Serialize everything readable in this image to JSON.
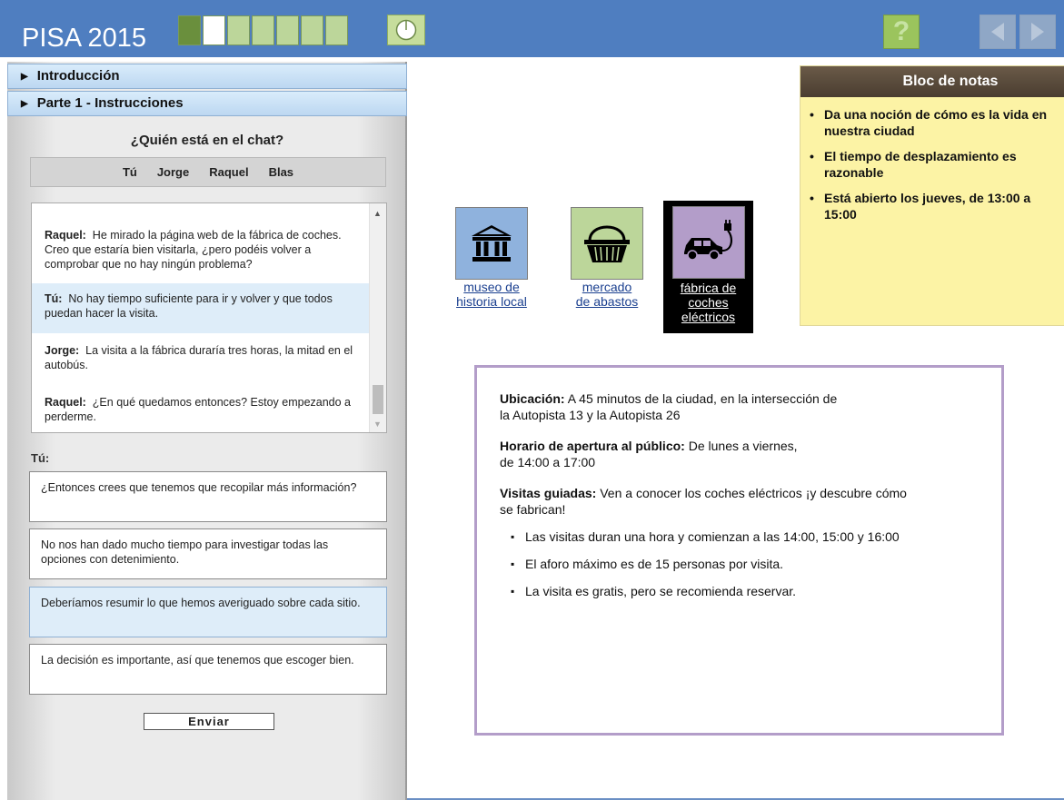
{
  "header": {
    "title": "PISA 2015",
    "progress_total": 7,
    "progress_current": 2,
    "help_symbol": "?",
    "colors": {
      "bar": "#4f7ec0",
      "progress_done": "#6a8f3d",
      "progress_current": "#ffffff",
      "progress_todo": "#bcd69a"
    }
  },
  "left_panel": {
    "sections": [
      {
        "label": "Introducción"
      },
      {
        "label": "Parte 1 - Instrucciones"
      }
    ],
    "chat": {
      "question": "¿Quién está en el chat?",
      "participants": [
        "Tú",
        "Jorge",
        "Raquel",
        "Blas"
      ],
      "messages": [
        {
          "speaker": "Raquel:",
          "text": "He mirado la página web de la fábrica de coches. Creo que estaría bien visitarla, ¿pero podéis volver a comprobar que no hay ningún problema?"
        },
        {
          "speaker": "Tú:",
          "text": "No hay tiempo suficiente para ir y volver y que todos puedan hacer la visita."
        },
        {
          "speaker": "Jorge:",
          "text": "La visita a la fábrica duraría tres horas, la mitad en el autobús."
        },
        {
          "speaker": "Raquel:",
          "text": "¿En qué quedamos entonces? Estoy empezando a perderme."
        }
      ]
    },
    "you_label": "Tú:",
    "options": [
      {
        "text": "¿Entonces crees que tenemos que recopilar más información?"
      },
      {
        "text": "No nos han dado mucho tiempo para investigar todas las opciones con detenimiento."
      },
      {
        "text": "Deberíamos resumir lo que hemos averiguado sobre cada sitio."
      },
      {
        "text": "La decisión es importante, así que tenemos que escoger bien."
      }
    ],
    "send_label": "Enviar"
  },
  "sites": [
    {
      "label_line1": "museo de",
      "label_line2": "historia local",
      "icon": "museum-icon"
    },
    {
      "label_line1": "mercado",
      "label_line2": "de abastos",
      "icon": "basket-icon"
    },
    {
      "label_line1": "fábrica de",
      "label_line2": "coches",
      "label_line3": "eléctricos",
      "icon": "electric-car-icon"
    }
  ],
  "notepad": {
    "title": "Bloc de notas",
    "items": [
      "Da una noción de cómo es la vida en nuestra ciudad",
      "El tiempo de desplazamiento es razonable",
      "Está abierto los jueves, de 13:00 a 15:00"
    ]
  },
  "info": {
    "location_label": "Ubicación:",
    "location_text_1": "A 45 minutos de la ciudad, en la intersección de",
    "location_text_2": "la Autopista 13 y la Autopista 26",
    "hours_label": "Horario de apertura al público:",
    "hours_text_1": "De lunes a viernes,",
    "hours_text_2": "de 14:00 a 17:00",
    "tours_label": "Visitas guiadas:",
    "tours_text_1": "Ven a conocer los coches eléctricos ¡y descubre cómo",
    "tours_text_2": "se fabrican!",
    "bullets": [
      "Las visitas duran una hora y comienzan a las 14:00, 15:00 y 16:00",
      "El aforo máximo es de 15 personas por visita.",
      "La visita es gratis, pero se recomienda reservar."
    ]
  }
}
